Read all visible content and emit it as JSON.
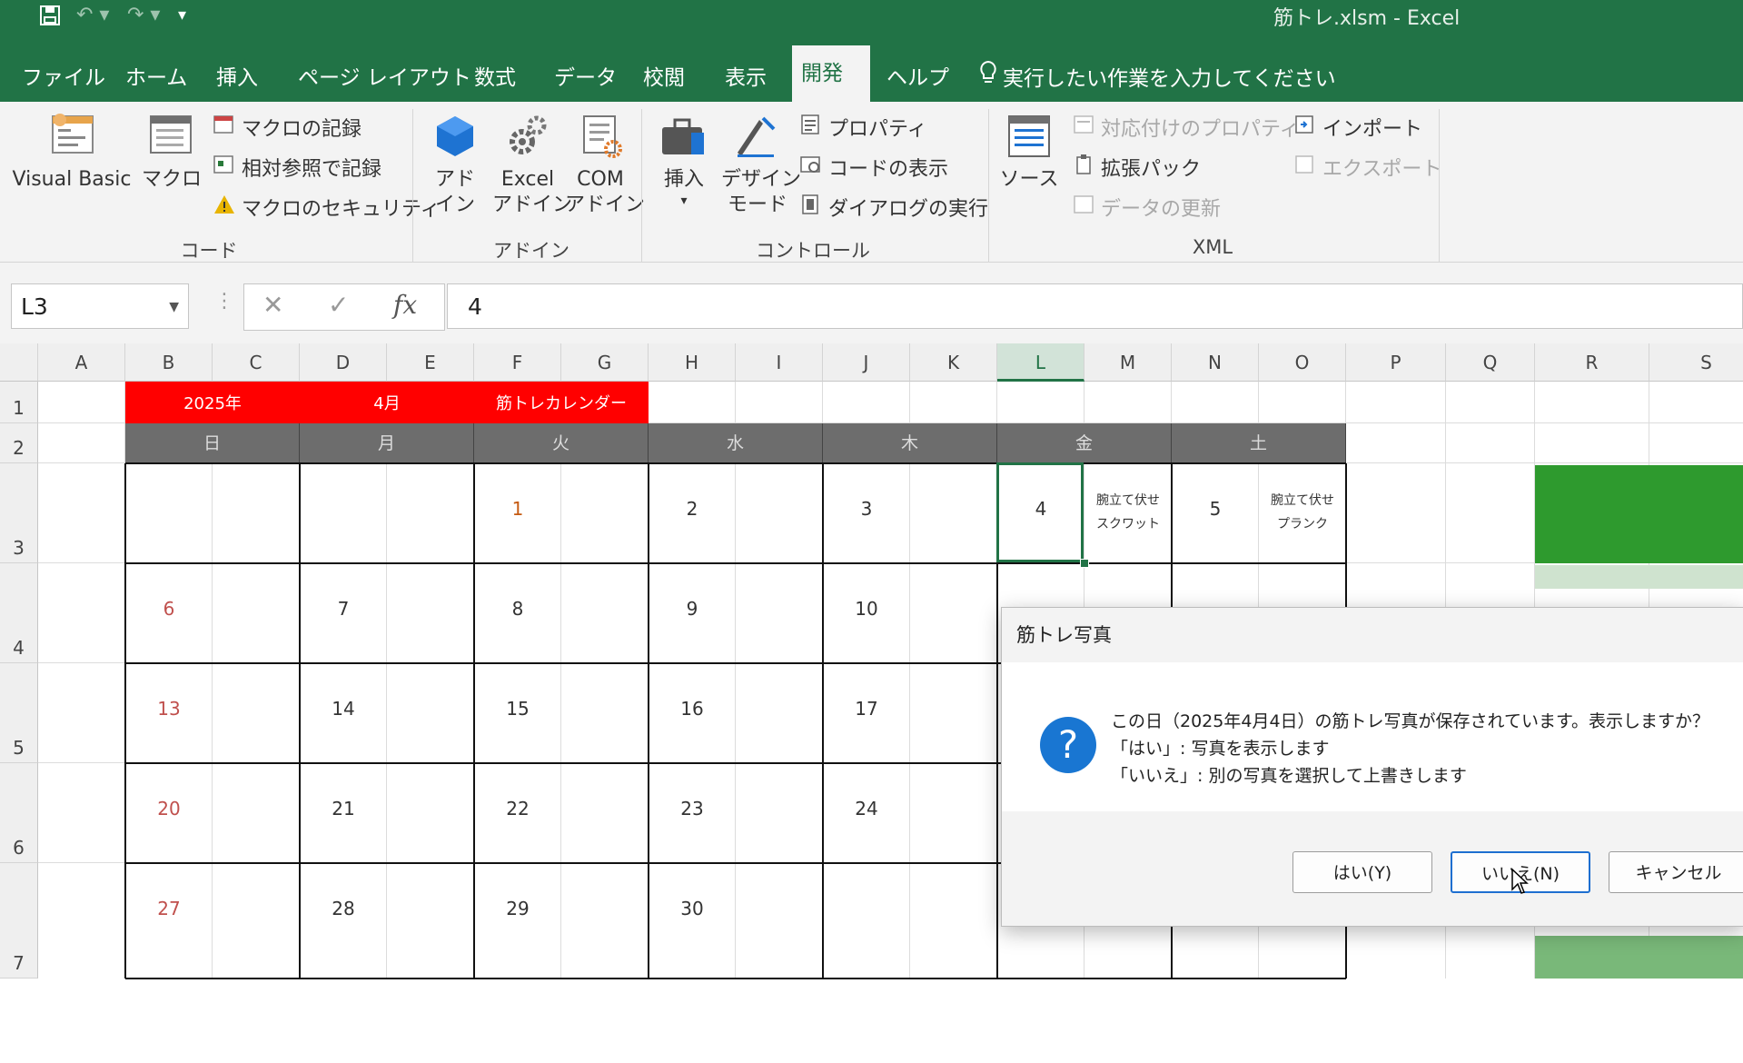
{
  "window": {
    "title": "筋トレ.xlsm  -  Excel"
  },
  "qat": {
    "save_icon": "save-icon",
    "undo_icon": "undo-icon",
    "redo_icon": "redo-icon"
  },
  "tabs": [
    "ファイル",
    "ホーム",
    "挿入",
    "ページ レイアウト",
    "数式",
    "データ",
    "校閲",
    "表示",
    "開発",
    "ヘルプ"
  ],
  "tell_me": "実行したい作業を入力してください",
  "ribbon": {
    "code": {
      "visual_basic": "Visual Basic",
      "macro": "マクロ",
      "record_macro": "マクロの記録",
      "relative_ref": "相対参照で記録",
      "macro_security": "マクロのセキュリティ",
      "group": "コード"
    },
    "addins": {
      "addin_line1": "アド",
      "addin_line2": "イン",
      "excel_line1": "Excel",
      "excel_line2": "アドイン",
      "com_line1": "COM",
      "com_line2": "アドイン",
      "group": "アドイン"
    },
    "controls": {
      "insert": "挿入",
      "design_line1": "デザイン",
      "design_line2": "モード",
      "properties": "プロパティ",
      "view_code": "コードの表示",
      "run_dialog": "ダイアログの実行",
      "group": "コントロール"
    },
    "xml": {
      "source": "ソース",
      "map_properties": "対応付けのプロパティ",
      "expansion_packs": "拡張パック",
      "refresh_data": "データの更新",
      "import": "インポート",
      "export": "エクスポート",
      "group": "XML"
    }
  },
  "formula_bar": {
    "name_box": "L3",
    "formula": "4",
    "fx": "fx"
  },
  "columns": [
    "A",
    "B",
    "C",
    "D",
    "E",
    "F",
    "G",
    "H",
    "I",
    "J",
    "K",
    "L",
    "M",
    "N",
    "O",
    "P",
    "Q",
    "R",
    "S"
  ],
  "rows": [
    "1",
    "2",
    "3",
    "4",
    "5",
    "6",
    "7"
  ],
  "calendar": {
    "year": "2025年",
    "month": "4月",
    "title": "筋トレカレンダー",
    "weekdays": [
      "日",
      "月",
      "火",
      "水",
      "木",
      "金",
      "土"
    ],
    "weeks": [
      [
        "",
        "",
        "1",
        "2",
        "3",
        "4",
        "5"
      ],
      [
        "6",
        "7",
        "8",
        "9",
        "10",
        "",
        ""
      ],
      [
        "13",
        "14",
        "15",
        "16",
        "17",
        "",
        ""
      ],
      [
        "20",
        "21",
        "22",
        "23",
        "24",
        "",
        ""
      ],
      [
        "27",
        "28",
        "29",
        "30",
        "",
        "",
        ""
      ]
    ],
    "note_fri": {
      "line1": "腕立て伏せ",
      "line2": "スクワット"
    },
    "note_sat": {
      "line1": "腕立て伏せ",
      "line2": "プランク"
    }
  },
  "dialog": {
    "title": "筋トレ写真",
    "line1": "この日（2025年4月4日）の筋トレ写真が保存されています。表示しますか？",
    "line2": "「はい」: 写真を表示します",
    "line3": "「いいえ」: 別の写真を選択して上書きします",
    "yes": "はい(Y)",
    "no": "いいえ(N)",
    "cancel": "キャンセル"
  },
  "colors": {
    "excel_green": "#217346",
    "header_red": "#ff0000",
    "weekday_gray": "#6d6d6d",
    "cell_green": "#2e9a2e"
  }
}
